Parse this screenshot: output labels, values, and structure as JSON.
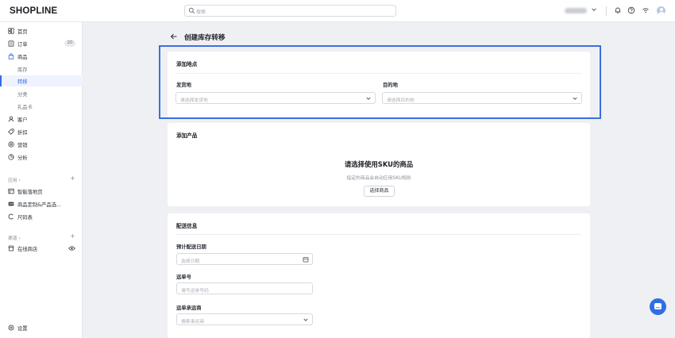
{
  "topbar": {
    "logo": "SHOPLINE",
    "search_placeholder": "搜索"
  },
  "sidebar": {
    "items": [
      {
        "label": "首页",
        "icon": "home-icon"
      },
      {
        "label": "订单",
        "icon": "order-icon",
        "badge": "20"
      },
      {
        "label": "商品",
        "icon": "product-icon"
      },
      {
        "label": "库存"
      },
      {
        "label": "转移"
      },
      {
        "label": "分类"
      },
      {
        "label": "礼品卡"
      },
      {
        "label": "客户",
        "icon": "customer-icon"
      },
      {
        "label": "折扣",
        "icon": "discount-icon"
      },
      {
        "label": "营销",
        "icon": "marketing-icon"
      },
      {
        "label": "分析",
        "icon": "analytics-icon"
      }
    ],
    "apps_section": "应用 ›",
    "apps": [
      {
        "label": "智能落地页",
        "icon": "landing-icon"
      },
      {
        "label": "商品定制&产品选...",
        "icon": "customize-icon"
      },
      {
        "label": "尺码表",
        "icon": "size-chart-icon"
      }
    ],
    "channels_section": "渠道 ›",
    "channels": [
      {
        "label": "在线商店",
        "icon": "store-icon"
      }
    ],
    "settings": "设置"
  },
  "page": {
    "title": "创建库存转移"
  },
  "location_card": {
    "title": "添加地点",
    "origin_label": "发货地",
    "origin_placeholder": "请选择发货地",
    "destination_label": "目的地",
    "destination_placeholder": "请选择目的地"
  },
  "product_card": {
    "title": "添加产品",
    "empty_title": "请选择使用SKU的商品",
    "empty_subtitle": "指定的商品会自动应用SKU规则",
    "select_button": "选择商品"
  },
  "shipping_card": {
    "title": "配送信息",
    "date_label": "预计配送日期",
    "date_placeholder": "选择日期",
    "tracking_label": "运单号",
    "tracking_placeholder": "请写运单号码",
    "carrier_label": "运单承运商",
    "carrier_placeholder": "搜索承运商"
  },
  "colors": {
    "accent": "#356ae6",
    "highlight": "#3b6fe0",
    "chat": "#2f6fe3"
  }
}
